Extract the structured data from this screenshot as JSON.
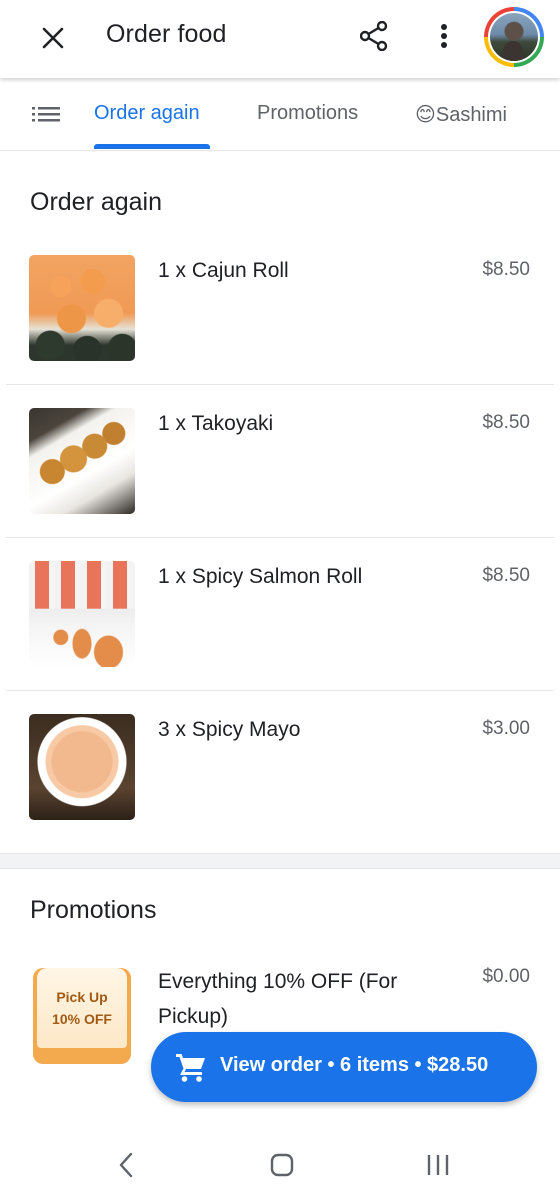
{
  "appbar": {
    "title": "Order food",
    "close_icon": "close-icon",
    "share_icon": "share-icon",
    "more_icon": "more-vert-icon"
  },
  "tabs": {
    "items": [
      {
        "label": "Order again",
        "active": true
      },
      {
        "label": "Promotions",
        "active": false
      },
      {
        "label": "😊Sashimi",
        "active": false
      }
    ]
  },
  "order_again": {
    "title": "Order again",
    "items": [
      {
        "name": "1 x Cajun Roll",
        "price": "$8.50"
      },
      {
        "name": "1 x Takoyaki",
        "price": "$8.50"
      },
      {
        "name": "1 x Spicy Salmon Roll",
        "price": "$8.50"
      },
      {
        "name": "3 x Spicy Mayo",
        "price": "$3.00"
      }
    ]
  },
  "promotions": {
    "title": "Promotions",
    "items": [
      {
        "badge_line1": "Pick Up",
        "badge_line2": "10% OFF",
        "name": "Everything 10% OFF (For Pickup)",
        "price": "$0.00"
      }
    ]
  },
  "fab": {
    "label": "View order • 6 items • $28.50"
  },
  "colors": {
    "accent": "#1a73e8",
    "text_primary": "#202124",
    "text_secondary": "#5f6368"
  }
}
